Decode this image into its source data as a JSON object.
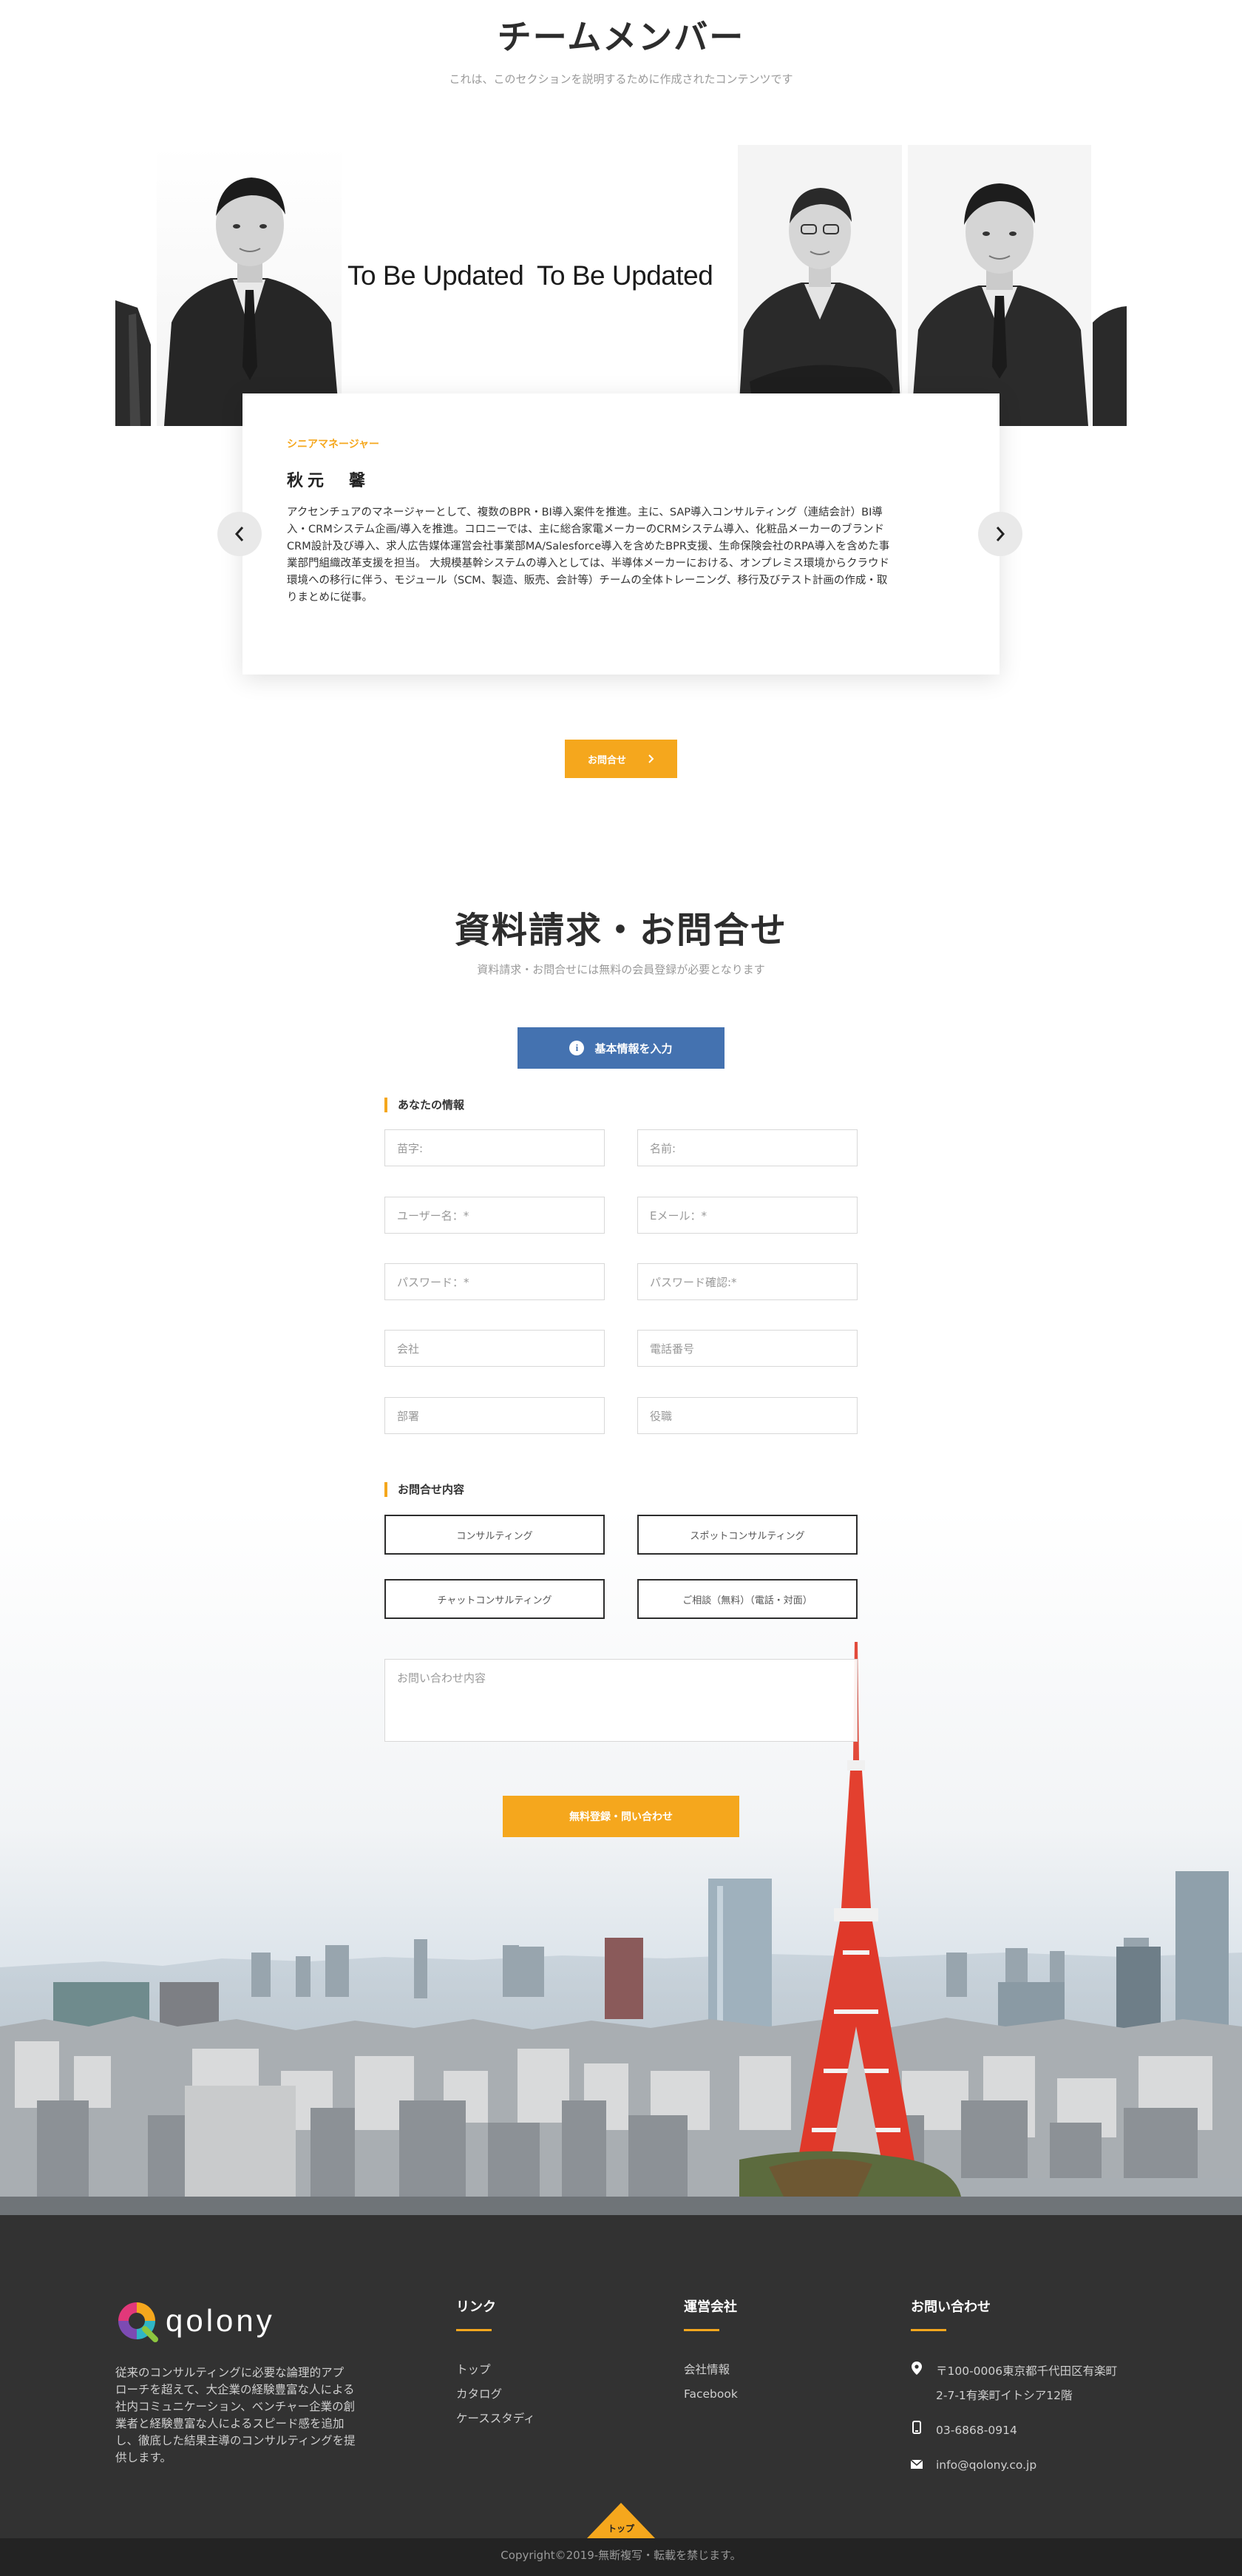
{
  "team": {
    "title": "チームメンバー",
    "subtitle": "これは、このセクションを説明するために作成されたコンテンツです",
    "placeholder_left": "To Be Updated",
    "placeholder_right": "To Be Updated",
    "member": {
      "role": "シニアマネージャー",
      "name": "秋元　馨",
      "description_lines": [
        "アクセンチュアのマネージャーとして、複数のBPR・BI導入案件を推進。主に、SAP導入コンサルティング（連結会計）BI導",
        "入・CRMシステム企画/導入を推進。コロニーでは、主に総合家電メーカーのCRMシステム導入、化粧品メーカーのブランド",
        "CRM設計及び導入、求人広告媒体運営会社事業部MA/Salesforce導入を含めたBPR支援、生命保険会社のRPA導入を含めた事",
        "業部門組織改革支援を担当。 大規模基幹システムの導入としては、半導体メーカーにおける、オンプレミス環境からクラウド",
        "環境への移行に伴う、モジュール（SCM、製造、販売、会計等）チームの全体トレーニング、移行及びテスト計画の作成・取",
        "りまとめに従事。"
      ]
    },
    "prev_icon": "chevron-left-icon",
    "next_icon": "chevron-right-icon",
    "contact_button": "お問合せ"
  },
  "form": {
    "title": "資料請求・お問合せ",
    "subtitle": "資料請求・お問合せには無料の会員登録が必要となります",
    "basic_info_button": "基本情報を入力",
    "your_info_label": "あなたの情報",
    "fields": {
      "last_name": "苗字:",
      "first_name": "名前:",
      "username": "ユーザー名：*",
      "email": "Eメール：*",
      "password": "パスワード：*",
      "password_confirm": "パスワード確認:*",
      "company": "会社",
      "phone": "電話番号",
      "department": "部署",
      "position": "役職"
    },
    "inquiry_label": "お問合せ内容",
    "choices": [
      "コンサルティング",
      "スポットコンサルティング",
      "チャットコンサルティング",
      "ご相談（無料）（電話・対面）"
    ],
    "message_placeholder": "お問い合わせ内容",
    "submit": "無料登録・問い合わせ"
  },
  "footer": {
    "brand": "qolony",
    "about_lines": [
      "従来のコンサルティングに必要な論理的アプ",
      "ローチを超えて、大企業の経験豊富な人による",
      "社内コミュニケーション、ベンチャー企業の創",
      "業者と経験豊富な人によるスピード感を追加",
      "し、徹底した結果主導のコンサルティングを提",
      "供します。"
    ],
    "links_title": "リンク",
    "links": [
      "トップ",
      "カタログ",
      "ケーススタディ"
    ],
    "company_title": "運営会社",
    "company_links": [
      "会社情報",
      "Facebook"
    ],
    "contact_title": "お問い合わせ",
    "address_line1": "〒100-0006東京都千代田区有楽町",
    "address_line2": "2-7-1有楽町イトシア12階",
    "phone": "03-6868-0914",
    "email": "info@qolony.co.jp",
    "to_top": "トップ",
    "copyright": "Copyright©2019-無断複写・転載を禁じます。"
  },
  "colors": {
    "accent": "#f5a71d",
    "primary_blue": "#4472b0",
    "footer_bg": "#323232",
    "footer_bottom_bg": "#232323"
  }
}
